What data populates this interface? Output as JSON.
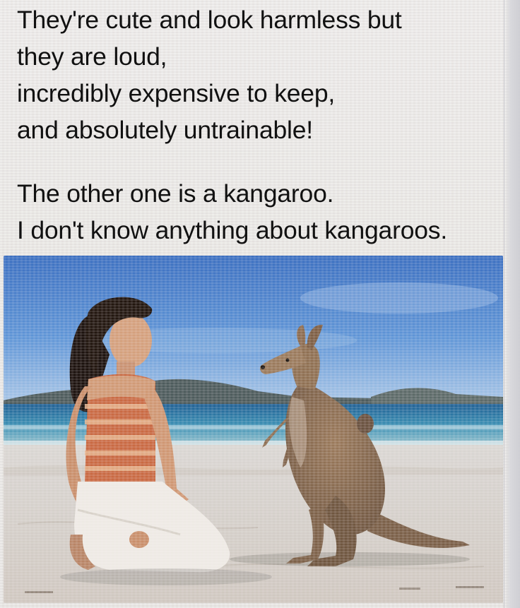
{
  "caption": {
    "lines": [
      "They're cute and look harmless but",
      "they are loud,",
      "incredibly expensive to keep,",
      "and absolutely untrainable!"
    ],
    "second_lines": [
      "The other one is a kangaroo.",
      "I don't know anything about kangaroos."
    ]
  },
  "photo": {
    "subject": "woman kneeling on beach facing a kangaroo",
    "colors": {
      "sky": "#3f7fc7",
      "sea": "#2f7fa6",
      "sand": "#d9d3cc",
      "kangaroo": "#8a6a4e"
    }
  }
}
